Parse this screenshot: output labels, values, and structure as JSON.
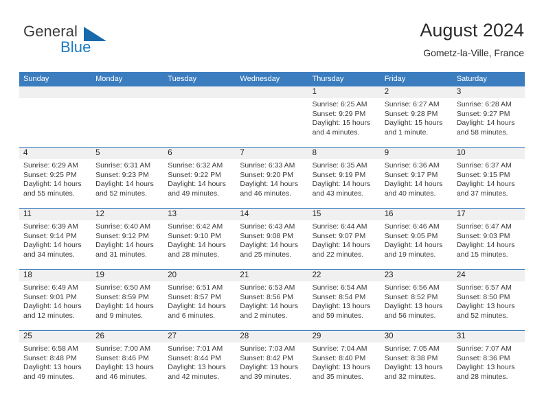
{
  "logo": {
    "word1": "General",
    "word2": "Blue",
    "triangle_color": "#1769ab",
    "blue_color": "#1a7bc4"
  },
  "header": {
    "title": "August 2024",
    "subtitle": "Gometz-la-Ville, France"
  },
  "theme": {
    "header_blue": "#3b7dbf",
    "daynum_band": "#f0f0f0",
    "text": "#3a3a3a"
  },
  "weekdays": [
    "Sunday",
    "Monday",
    "Tuesday",
    "Wednesday",
    "Thursday",
    "Friday",
    "Saturday"
  ],
  "weeks": [
    [
      {
        "day": "",
        "sunrise": "",
        "sunset": "",
        "daylight1": "",
        "daylight2": ""
      },
      {
        "day": "",
        "sunrise": "",
        "sunset": "",
        "daylight1": "",
        "daylight2": ""
      },
      {
        "day": "",
        "sunrise": "",
        "sunset": "",
        "daylight1": "",
        "daylight2": ""
      },
      {
        "day": "",
        "sunrise": "",
        "sunset": "",
        "daylight1": "",
        "daylight2": ""
      },
      {
        "day": "1",
        "sunrise": "Sunrise: 6:25 AM",
        "sunset": "Sunset: 9:29 PM",
        "daylight1": "Daylight: 15 hours",
        "daylight2": "and 4 minutes."
      },
      {
        "day": "2",
        "sunrise": "Sunrise: 6:27 AM",
        "sunset": "Sunset: 9:28 PM",
        "daylight1": "Daylight: 15 hours",
        "daylight2": "and 1 minute."
      },
      {
        "day": "3",
        "sunrise": "Sunrise: 6:28 AM",
        "sunset": "Sunset: 9:27 PM",
        "daylight1": "Daylight: 14 hours",
        "daylight2": "and 58 minutes."
      }
    ],
    [
      {
        "day": "4",
        "sunrise": "Sunrise: 6:29 AM",
        "sunset": "Sunset: 9:25 PM",
        "daylight1": "Daylight: 14 hours",
        "daylight2": "and 55 minutes."
      },
      {
        "day": "5",
        "sunrise": "Sunrise: 6:31 AM",
        "sunset": "Sunset: 9:23 PM",
        "daylight1": "Daylight: 14 hours",
        "daylight2": "and 52 minutes."
      },
      {
        "day": "6",
        "sunrise": "Sunrise: 6:32 AM",
        "sunset": "Sunset: 9:22 PM",
        "daylight1": "Daylight: 14 hours",
        "daylight2": "and 49 minutes."
      },
      {
        "day": "7",
        "sunrise": "Sunrise: 6:33 AM",
        "sunset": "Sunset: 9:20 PM",
        "daylight1": "Daylight: 14 hours",
        "daylight2": "and 46 minutes."
      },
      {
        "day": "8",
        "sunrise": "Sunrise: 6:35 AM",
        "sunset": "Sunset: 9:19 PM",
        "daylight1": "Daylight: 14 hours",
        "daylight2": "and 43 minutes."
      },
      {
        "day": "9",
        "sunrise": "Sunrise: 6:36 AM",
        "sunset": "Sunset: 9:17 PM",
        "daylight1": "Daylight: 14 hours",
        "daylight2": "and 40 minutes."
      },
      {
        "day": "10",
        "sunrise": "Sunrise: 6:37 AM",
        "sunset": "Sunset: 9:15 PM",
        "daylight1": "Daylight: 14 hours",
        "daylight2": "and 37 minutes."
      }
    ],
    [
      {
        "day": "11",
        "sunrise": "Sunrise: 6:39 AM",
        "sunset": "Sunset: 9:14 PM",
        "daylight1": "Daylight: 14 hours",
        "daylight2": "and 34 minutes."
      },
      {
        "day": "12",
        "sunrise": "Sunrise: 6:40 AM",
        "sunset": "Sunset: 9:12 PM",
        "daylight1": "Daylight: 14 hours",
        "daylight2": "and 31 minutes."
      },
      {
        "day": "13",
        "sunrise": "Sunrise: 6:42 AM",
        "sunset": "Sunset: 9:10 PM",
        "daylight1": "Daylight: 14 hours",
        "daylight2": "and 28 minutes."
      },
      {
        "day": "14",
        "sunrise": "Sunrise: 6:43 AM",
        "sunset": "Sunset: 9:08 PM",
        "daylight1": "Daylight: 14 hours",
        "daylight2": "and 25 minutes."
      },
      {
        "day": "15",
        "sunrise": "Sunrise: 6:44 AM",
        "sunset": "Sunset: 9:07 PM",
        "daylight1": "Daylight: 14 hours",
        "daylight2": "and 22 minutes."
      },
      {
        "day": "16",
        "sunrise": "Sunrise: 6:46 AM",
        "sunset": "Sunset: 9:05 PM",
        "daylight1": "Daylight: 14 hours",
        "daylight2": "and 19 minutes."
      },
      {
        "day": "17",
        "sunrise": "Sunrise: 6:47 AM",
        "sunset": "Sunset: 9:03 PM",
        "daylight1": "Daylight: 14 hours",
        "daylight2": "and 15 minutes."
      }
    ],
    [
      {
        "day": "18",
        "sunrise": "Sunrise: 6:49 AM",
        "sunset": "Sunset: 9:01 PM",
        "daylight1": "Daylight: 14 hours",
        "daylight2": "and 12 minutes."
      },
      {
        "day": "19",
        "sunrise": "Sunrise: 6:50 AM",
        "sunset": "Sunset: 8:59 PM",
        "daylight1": "Daylight: 14 hours",
        "daylight2": "and 9 minutes."
      },
      {
        "day": "20",
        "sunrise": "Sunrise: 6:51 AM",
        "sunset": "Sunset: 8:57 PM",
        "daylight1": "Daylight: 14 hours",
        "daylight2": "and 6 minutes."
      },
      {
        "day": "21",
        "sunrise": "Sunrise: 6:53 AM",
        "sunset": "Sunset: 8:56 PM",
        "daylight1": "Daylight: 14 hours",
        "daylight2": "and 2 minutes."
      },
      {
        "day": "22",
        "sunrise": "Sunrise: 6:54 AM",
        "sunset": "Sunset: 8:54 PM",
        "daylight1": "Daylight: 13 hours",
        "daylight2": "and 59 minutes."
      },
      {
        "day": "23",
        "sunrise": "Sunrise: 6:56 AM",
        "sunset": "Sunset: 8:52 PM",
        "daylight1": "Daylight: 13 hours",
        "daylight2": "and 56 minutes."
      },
      {
        "day": "24",
        "sunrise": "Sunrise: 6:57 AM",
        "sunset": "Sunset: 8:50 PM",
        "daylight1": "Daylight: 13 hours",
        "daylight2": "and 52 minutes."
      }
    ],
    [
      {
        "day": "25",
        "sunrise": "Sunrise: 6:58 AM",
        "sunset": "Sunset: 8:48 PM",
        "daylight1": "Daylight: 13 hours",
        "daylight2": "and 49 minutes."
      },
      {
        "day": "26",
        "sunrise": "Sunrise: 7:00 AM",
        "sunset": "Sunset: 8:46 PM",
        "daylight1": "Daylight: 13 hours",
        "daylight2": "and 46 minutes."
      },
      {
        "day": "27",
        "sunrise": "Sunrise: 7:01 AM",
        "sunset": "Sunset: 8:44 PM",
        "daylight1": "Daylight: 13 hours",
        "daylight2": "and 42 minutes."
      },
      {
        "day": "28",
        "sunrise": "Sunrise: 7:03 AM",
        "sunset": "Sunset: 8:42 PM",
        "daylight1": "Daylight: 13 hours",
        "daylight2": "and 39 minutes."
      },
      {
        "day": "29",
        "sunrise": "Sunrise: 7:04 AM",
        "sunset": "Sunset: 8:40 PM",
        "daylight1": "Daylight: 13 hours",
        "daylight2": "and 35 minutes."
      },
      {
        "day": "30",
        "sunrise": "Sunrise: 7:05 AM",
        "sunset": "Sunset: 8:38 PM",
        "daylight1": "Daylight: 13 hours",
        "daylight2": "and 32 minutes."
      },
      {
        "day": "31",
        "sunrise": "Sunrise: 7:07 AM",
        "sunset": "Sunset: 8:36 PM",
        "daylight1": "Daylight: 13 hours",
        "daylight2": "and 28 minutes."
      }
    ]
  ]
}
